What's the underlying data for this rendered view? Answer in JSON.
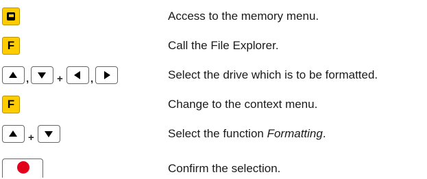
{
  "rows": [
    {
      "description": "Access to the memory menu."
    },
    {
      "description": "Call the File Explorer."
    },
    {
      "description": "Select the drive which is to be formatted."
    },
    {
      "description": "Change to the context menu."
    },
    {
      "description_prefix": "Select the function ",
      "description_emph": "Formatting",
      "description_suffix": "."
    },
    {
      "description": "Confirm the selection."
    }
  ],
  "keys": {
    "f_label": "F",
    "comma": ",",
    "plus": "+"
  },
  "icons": [
    "memory-key-icon",
    "f-key-icon",
    "up-arrow-key-icon",
    "down-arrow-key-icon",
    "left-arrow-key-icon",
    "right-arrow-key-icon",
    "record-key-icon"
  ],
  "colors": {
    "function_key": "#ffcc00",
    "record_dot": "#e3001b"
  }
}
